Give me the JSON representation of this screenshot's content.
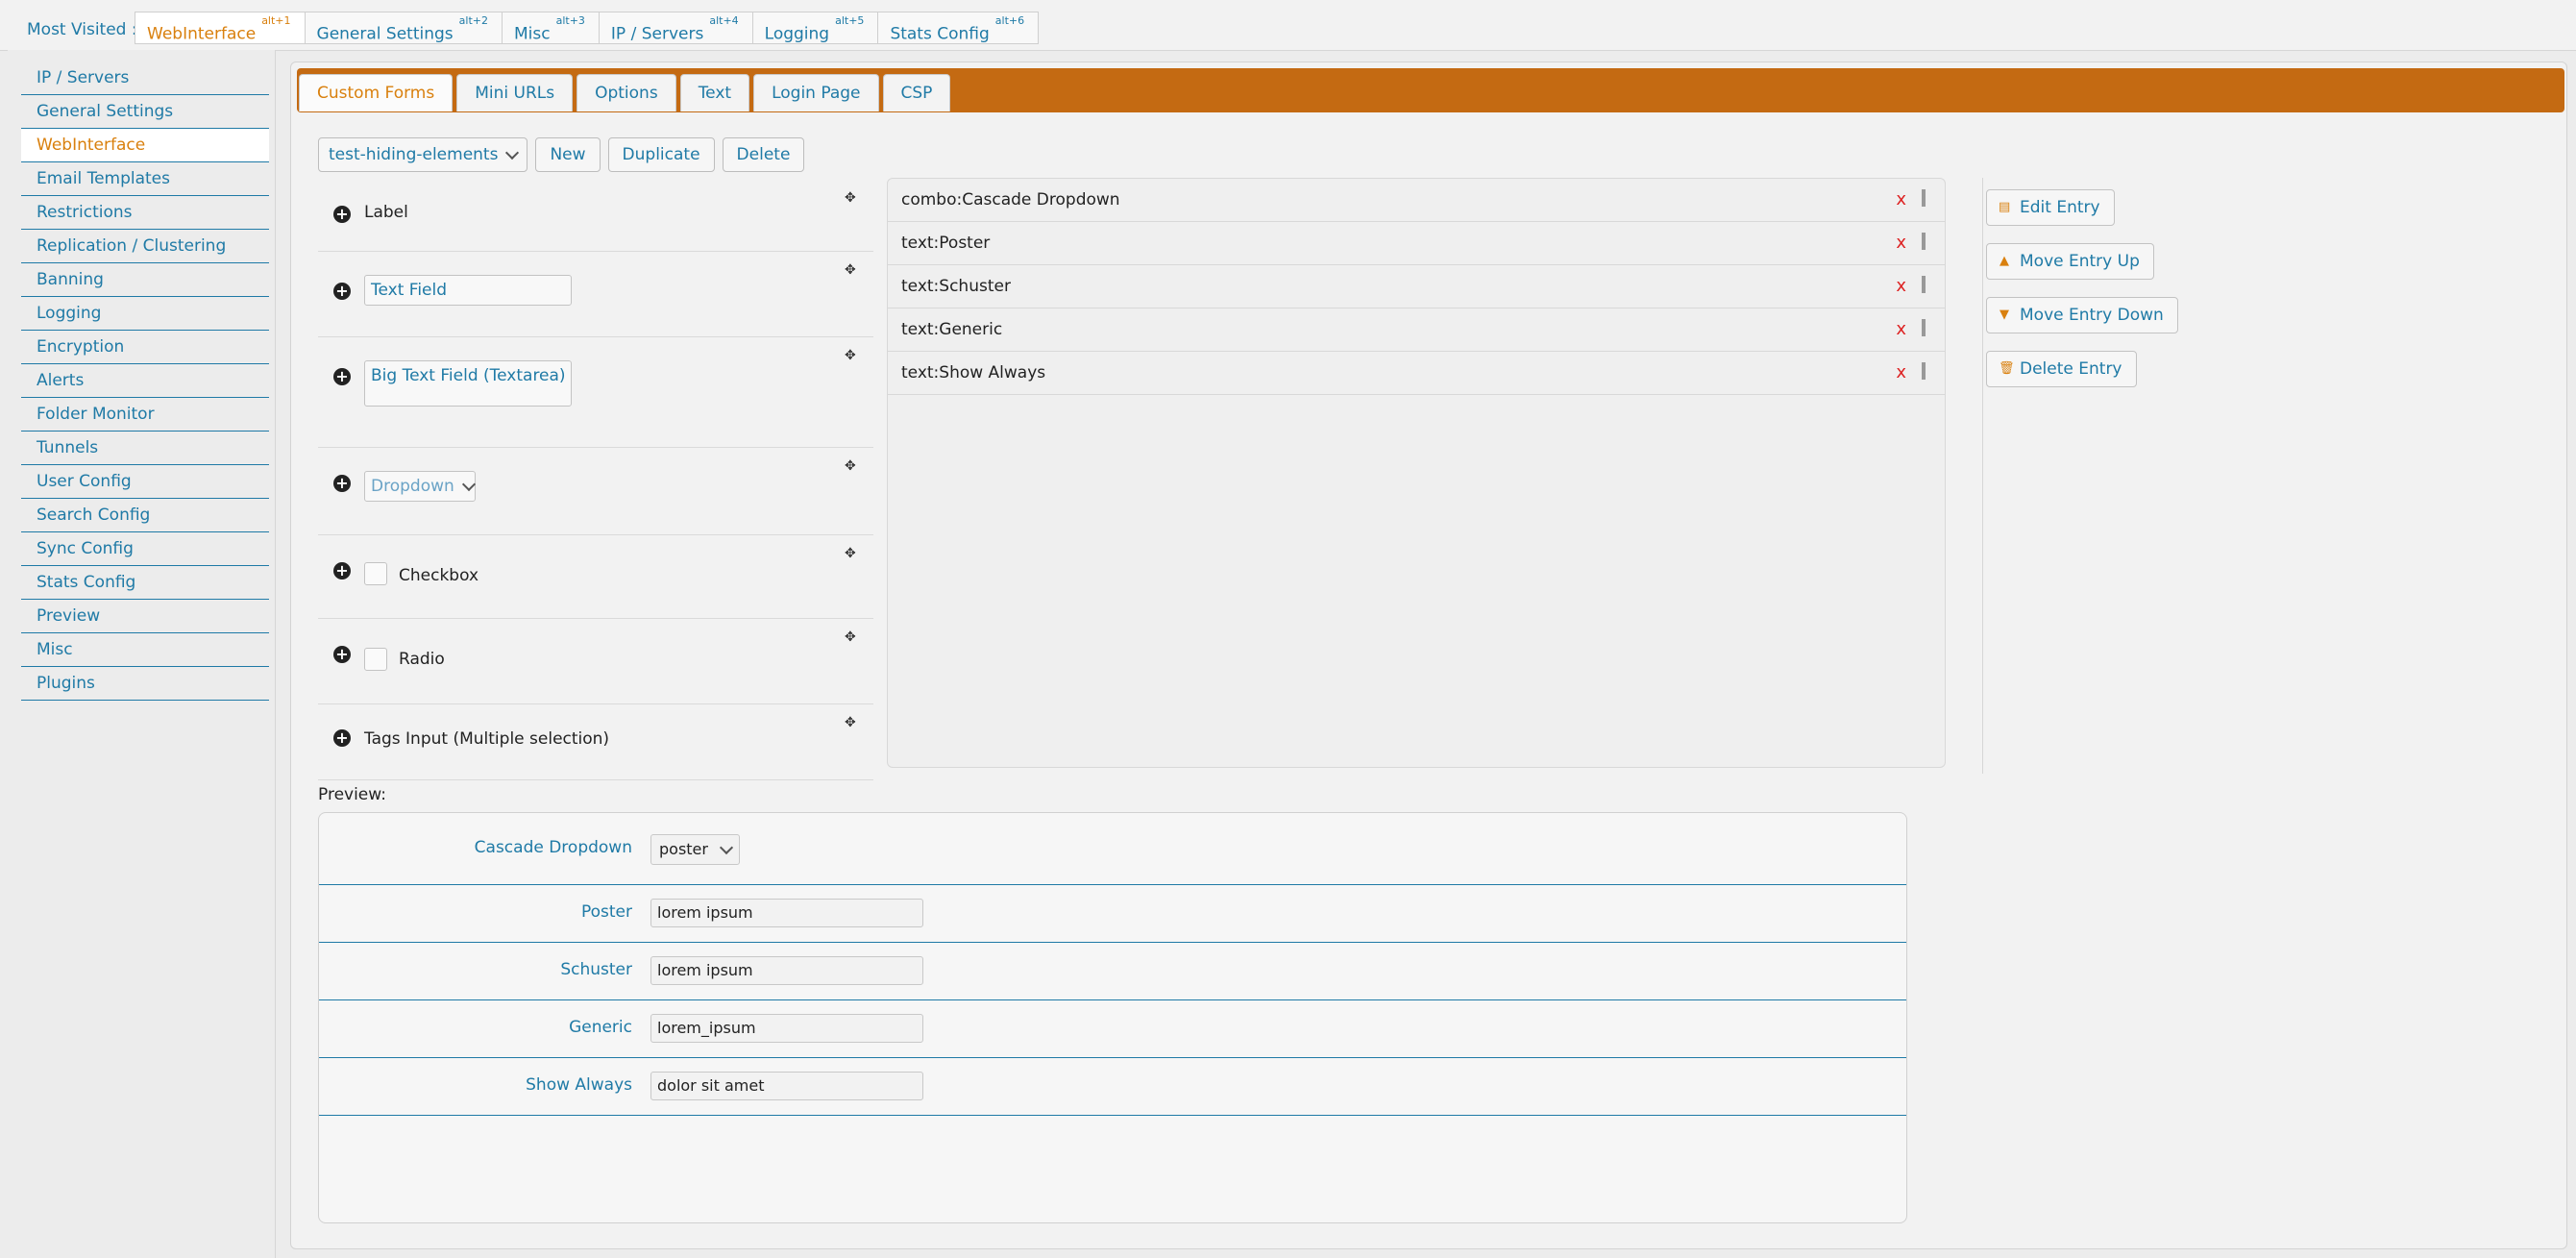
{
  "most_visited": {
    "label": "Most Visited :",
    "tabs": [
      {
        "label": "WebInterface",
        "shortcut": "alt+1",
        "active": true
      },
      {
        "label": "General Settings",
        "shortcut": "alt+2"
      },
      {
        "label": "Misc",
        "shortcut": "alt+3"
      },
      {
        "label": "IP / Servers",
        "shortcut": "alt+4"
      },
      {
        "label": "Logging",
        "shortcut": "alt+5"
      },
      {
        "label": "Stats Config",
        "shortcut": "alt+6"
      }
    ]
  },
  "sidebar": {
    "items": [
      {
        "label": "IP / Servers"
      },
      {
        "label": "General Settings"
      },
      {
        "label": "WebInterface",
        "active": true
      },
      {
        "label": "Email Templates"
      },
      {
        "label": "Restrictions"
      },
      {
        "label": "Replication / Clustering"
      },
      {
        "label": "Banning"
      },
      {
        "label": "Logging"
      },
      {
        "label": "Encryption"
      },
      {
        "label": "Alerts"
      },
      {
        "label": "Folder Monitor"
      },
      {
        "label": "Tunnels"
      },
      {
        "label": "User Config"
      },
      {
        "label": "Search Config"
      },
      {
        "label": "Sync Config"
      },
      {
        "label": "Stats Config"
      },
      {
        "label": "Preview"
      },
      {
        "label": "Misc"
      },
      {
        "label": "Plugins"
      }
    ]
  },
  "tabs": [
    {
      "label": "Custom Forms",
      "active": true
    },
    {
      "label": "Mini URLs"
    },
    {
      "label": "Options"
    },
    {
      "label": "Text"
    },
    {
      "label": "Login Page"
    },
    {
      "label": "CSP"
    }
  ],
  "form_select": {
    "selected": "test-hiding-elements",
    "new_label": "New",
    "duplicate_label": "Duplicate",
    "delete_label": "Delete"
  },
  "palette": {
    "label": "Label",
    "text_field": "Text Field",
    "textarea": "Big Text Field (Textarea)",
    "dropdown": "Dropdown",
    "checkbox": "Checkbox",
    "radio": "Radio",
    "tags": "Tags Input (Multiple selection)"
  },
  "entries": [
    "combo:Cascade Dropdown",
    "text:Poster",
    "text:Schuster",
    "text:Generic",
    "text:Show Always"
  ],
  "entry_remove": "x",
  "actions": {
    "edit": "Edit Entry",
    "up": "Move Entry Up",
    "down": "Move Entry Down",
    "delete": "Delete Entry"
  },
  "preview": {
    "title": "Preview:",
    "rows": [
      {
        "label": "Cascade Dropdown",
        "value": "poster",
        "type": "select"
      },
      {
        "label": "Poster",
        "value": "lorem ipsum"
      },
      {
        "label": "Schuster",
        "value": "lorem ipsum"
      },
      {
        "label": "Generic",
        "value": "lorem_ipsum"
      },
      {
        "label": "Show Always",
        "value": "dolor sit amet"
      }
    ]
  },
  "colors": {
    "accent_orange": "#c46a12",
    "active_text": "#d9800e",
    "link_blue": "#1f7aa6",
    "remove_red": "#dd2222"
  }
}
